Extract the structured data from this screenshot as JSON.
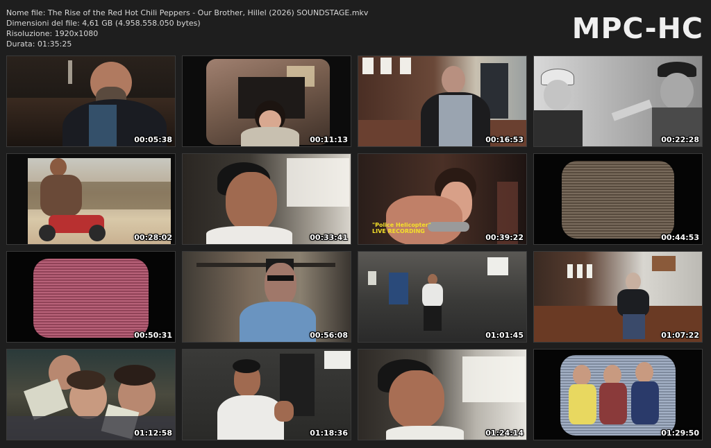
{
  "file_info": {
    "name_line": "Nome file: The Rise of the Red Hot Chili Peppers - Our Brother, Hillel (2026) SOUNDSTAGE.mkv",
    "size_line": "Dimensioni del file: 4,61 GB (4.958.558.050 bytes)",
    "resolution_line": "Risoluzione: 1920x1080",
    "duration_line": "Durata: 01:35:25"
  },
  "logo": "MPC-HC",
  "thumbnails": [
    {
      "time": "00:05:38"
    },
    {
      "time": "00:11:13"
    },
    {
      "time": "00:16:53"
    },
    {
      "time": "00:22:28"
    },
    {
      "time": "00:28:02"
    },
    {
      "time": "00:33:41"
    },
    {
      "time": "00:39:22",
      "caption_1": "\"Police Helicopter\"",
      "caption_2": "LIVE RECORDING"
    },
    {
      "time": "00:44:53"
    },
    {
      "time": "00:50:31"
    },
    {
      "time": "00:56:08"
    },
    {
      "time": "01:01:45"
    },
    {
      "time": "01:07:22"
    },
    {
      "time": "01:12:58"
    },
    {
      "time": "01:18:36"
    },
    {
      "time": "01:24:14"
    },
    {
      "time": "01:29:50"
    }
  ]
}
